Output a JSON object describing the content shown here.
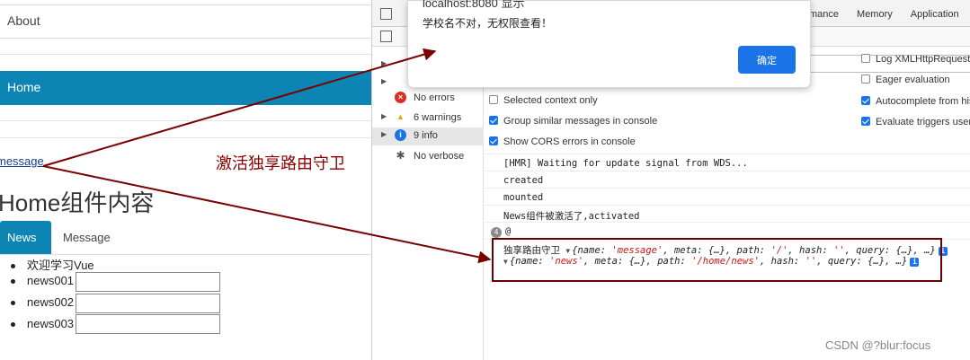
{
  "app": {
    "nav_about": "About",
    "nav_home": "Home",
    "message_link": "message",
    "home_title": "Home组件内容",
    "tabs": [
      "News",
      "Message"
    ],
    "news_items": [
      "欢迎学习Vue",
      "news001",
      "news002",
      "news003"
    ],
    "accent_color": "#0d85b4"
  },
  "annotation": "激活独享路由守卫",
  "dialog": {
    "title": "localhost:8080 显示",
    "message": "学校名不对，无权限查看！",
    "ok_label": "确定"
  },
  "devtools": {
    "tabs": [
      "mance",
      "Memory",
      "Application"
    ],
    "sidebar": [
      {
        "icon": "error-icon",
        "label": "No errors"
      },
      {
        "icon": "warning-icon",
        "label": "6 warnings"
      },
      {
        "icon": "info-icon",
        "label": "9 info"
      },
      {
        "icon": "verbose-icon",
        "label": "No verbose"
      }
    ],
    "options_left": [
      {
        "label": "Selected context only",
        "checked": false
      },
      {
        "label": "Group similar messages in console",
        "checked": true
      },
      {
        "label": "Show CORS errors in console",
        "checked": true
      }
    ],
    "options_right": [
      {
        "label": "Log XMLHttpRequests",
        "checked": false
      },
      {
        "label": "Eager evaluation",
        "checked": false
      },
      {
        "label": "Autocomplete from his",
        "checked": true
      },
      {
        "label": "Evaluate triggers user a",
        "checked": true
      }
    ],
    "console_lines": [
      "[HMR] Waiting for update signal from WDS...",
      "created",
      "mounted",
      "News组件被激活了,activated"
    ],
    "repeat_count": "4",
    "at_line": "@",
    "guard_label": "独享路由守卫",
    "obj1": {
      "open": "{name: ",
      "name": "'message'",
      "mid1": ", meta: {…}, path: ",
      "path": "'/'",
      "mid2": ", hash: ",
      "hash": "''",
      "tail": ", query: {…}, …}"
    },
    "obj2": {
      "open": "{name: ",
      "name": "'news'",
      "mid1": ", meta: {…}, path: ",
      "path": "'/home/news'",
      "mid2": ", hash: ",
      "hash": "''",
      "tail": ", query: {…}, …}"
    },
    "info_badge": "i"
  },
  "watermark": "CSDN @?blur:focus"
}
